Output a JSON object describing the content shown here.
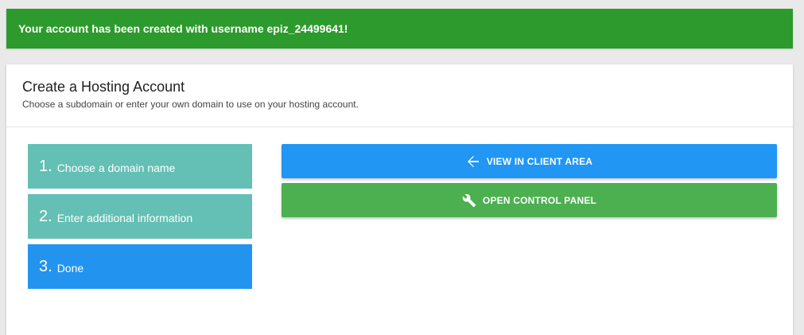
{
  "alert": {
    "message": "Your account has been created with username epiz_24499641!"
  },
  "card": {
    "title": "Create a Hosting Account",
    "subtitle": "Choose a subdomain or enter your own domain to use on your hosting account."
  },
  "steps": [
    {
      "number": "1.",
      "label": "Choose a domain name",
      "active": false
    },
    {
      "number": "2.",
      "label": "Enter additional information",
      "active": false
    },
    {
      "number": "3.",
      "label": "Done",
      "active": true
    }
  ],
  "actions": {
    "client_area": {
      "label": "VIEW IN CLIENT AREA",
      "icon": "arrow-left-icon"
    },
    "control_panel": {
      "label": "OPEN CONTROL PANEL",
      "icon": "wrench-icon"
    }
  },
  "colors": {
    "alert_bg": "#2c9a2c",
    "step_pending": "#64bfb4",
    "step_active": "#2294ef",
    "btn_blue": "#2196f3",
    "btn_green": "#4caf50"
  }
}
